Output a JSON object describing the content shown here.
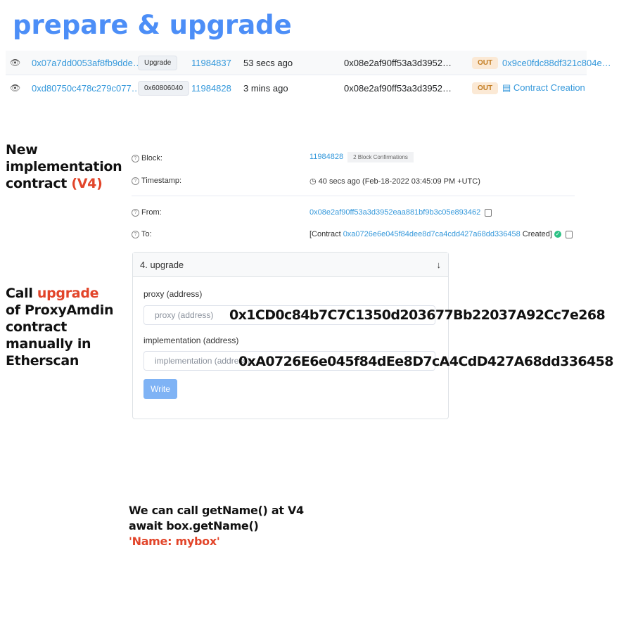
{
  "title": "prepare & upgrade",
  "tx_rows": [
    {
      "hash": "0x07a7dd0053af8fb9dde…",
      "method": "Upgrade",
      "block": "11984837",
      "age": "53 secs ago",
      "from": "0x08e2af90ff53a3d3952…",
      "direction": "OUT",
      "to": "0x9ce0fdc88df321c804e…"
    },
    {
      "hash": "0xd80750c478c279c077…",
      "method": "0x60806040",
      "block": "11984828",
      "age": "3 mins ago",
      "from": "0x08e2af90ff53a3d3952…",
      "direction": "OUT",
      "to": "Contract Creation"
    }
  ],
  "side_notes": {
    "new_impl": [
      "New",
      "implementation",
      "contract "
    ],
    "new_impl_highlight": "(V4)",
    "call_prefix": "Call ",
    "call_highlight": "upgrade",
    "call_rest": [
      "of ProxyAmdin",
      "contract",
      "manually in",
      "Etherscan"
    ]
  },
  "details": {
    "block_label": "Block:",
    "block_value": "11984828",
    "confirmations": "2 Block Confirmations",
    "timestamp_label": "Timestamp:",
    "timestamp_value": "40 secs ago (Feb-18-2022 03:45:09 PM +UTC)",
    "from_label": "From:",
    "from_value": "0x08e2af90ff53a3d3952eaa881bf9b3c05e893462",
    "to_label": "To:",
    "to_prefix": "[Contract ",
    "to_address": "0xa0726e6e045f84dee8d7ca4cdd427a68dd336458",
    "to_suffix": " Created]"
  },
  "write_card": {
    "header": "4. upgrade",
    "proxy_label": "proxy (address)",
    "proxy_placeholder": "proxy (address)",
    "impl_label": "implementation (address)",
    "impl_placeholder": "implementation (address)",
    "write_button": "Write"
  },
  "overlay_addresses": {
    "proxy": "0x1CD0c84b7C7C1350d203677Bb22037A92Cc7e268",
    "implementation": "0xA0726E6e045f84dEe8D7cA4CdD427A68dd336458"
  },
  "bottom_note": {
    "line1": "We can call getName() at V4",
    "line2": "await box.getName()",
    "line3": "'Name: mybox'"
  },
  "colors": {
    "accent_blue": "#4c8ef7",
    "highlight_red": "#e2452a",
    "link": "#3498db"
  }
}
